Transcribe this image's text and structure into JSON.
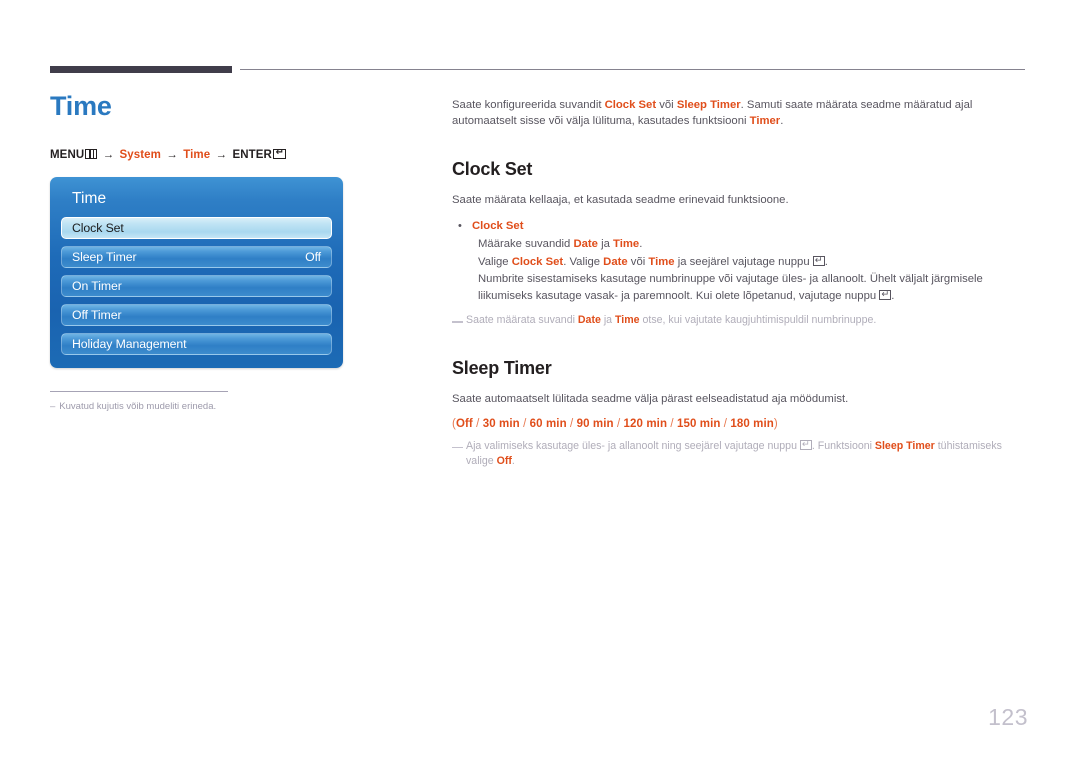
{
  "page": {
    "title": "Time",
    "number": "123"
  },
  "breadcrumb": {
    "menu_label": "MENU",
    "menu_icon": "menu-bars-icon",
    "arrow": "→",
    "step1": "System",
    "step2": "Time",
    "enter_label": "ENTER",
    "enter_icon": "enter-return-icon",
    "enter_glyph": "↵"
  },
  "osd": {
    "header": "Time",
    "items": [
      {
        "label": "Clock Set",
        "value": "",
        "selected": true
      },
      {
        "label": "Sleep Timer",
        "value": "Off",
        "selected": false
      },
      {
        "label": "On Timer",
        "value": "",
        "selected": false
      },
      {
        "label": "Off Timer",
        "value": "",
        "selected": false
      },
      {
        "label": "Holiday Management",
        "value": "",
        "selected": false
      }
    ]
  },
  "left_note": {
    "dash": "–",
    "text": "Kuvatud kujutis võib mudeliti erineda."
  },
  "intro": {
    "part1": "Saate konfigureerida suvandit ",
    "accent1": "Clock Set",
    "part2": " või ",
    "accent2": "Sleep Timer",
    "part3": ". Samuti saate määrata seadme määratud ajal automaatselt sisse või välja lülituma, kasutades funktsiooni ",
    "accent3": "Timer",
    "part4": "."
  },
  "clock_set": {
    "heading": "Clock Set",
    "lead": "Saate määrata kellaaja, et kasutada seadme erinevaid funktsioone.",
    "bullet_dot": "•",
    "bullet_title": "Clock Set",
    "line1": {
      "a": "Määrake suvandid ",
      "b": "Date",
      "c": " ja ",
      "d": "Time",
      "e": "."
    },
    "line2": {
      "a": "Valige ",
      "b": "Clock Set",
      "c": ". Valige ",
      "d": "Date",
      "e": " või ",
      "f": "Time",
      "g": " ja seejärel vajutage nuppu ",
      "h": "."
    },
    "line3": "Numbrite sisestamiseks kasutage numbrinuppe või vajutage üles- ja allanoolt. Ühelt väljalt järgmisele liikumiseks kasutage vasak- ja paremnoolt. Kui olete lõpetanud, vajutage nuppu ",
    "line3_end": ".",
    "note": {
      "a": "Saate määrata suvandi ",
      "b": "Date",
      "c": " ja ",
      "d": "Time",
      "e": " otse, kui vajutate kaugjuhtimispuldil numbrinuppe."
    }
  },
  "sleep_timer": {
    "heading": "Sleep Timer",
    "lead": "Saate automaatselt lülitada seadme välja pärast eelseadistatud aja möödumist.",
    "options_open": "(",
    "options": [
      "Off",
      "30 min",
      "60 min",
      "90 min",
      "120 min",
      "150 min",
      "180 min"
    ],
    "options_sep": " / ",
    "options_close": ")",
    "note": {
      "a": "Aja valimiseks kasutage üles- ja allanoolt ning seejärel vajutage nuppu ",
      "b": ". Funktsiooni ",
      "c": "Sleep Timer",
      "d": " tühistamiseks valige ",
      "e": "Off",
      "f": "."
    }
  },
  "colors": {
    "accent": "#e04e1b",
    "title_blue": "#2a79c0",
    "body_gray": "#58555f",
    "note_gray": "#b0adb9",
    "rule_dark": "#403d4a",
    "osd_blue": "#1e6bb8"
  }
}
